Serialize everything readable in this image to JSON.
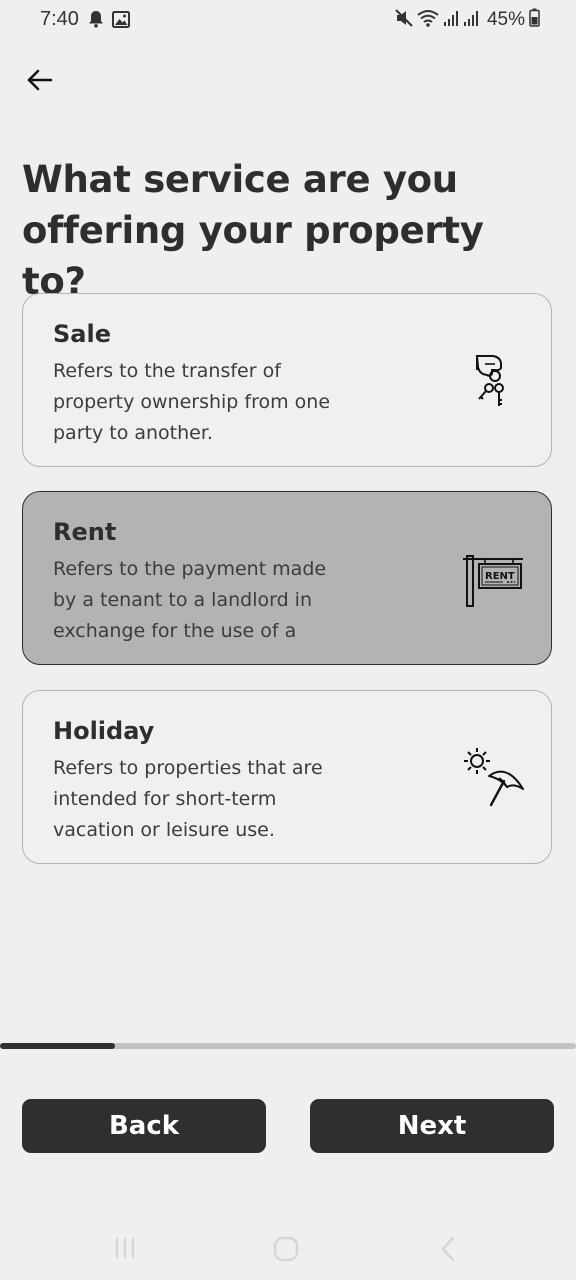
{
  "status_bar": {
    "time": "7:40",
    "battery": "45%",
    "icons": [
      "notification-bell-icon",
      "gallery-icon",
      "mute-icon",
      "wifi-icon",
      "signal-icon",
      "signal-icon",
      "battery-icon"
    ]
  },
  "header": {
    "back_icon": "arrow-left-icon",
    "title": "What service are you offering your property to?"
  },
  "options": [
    {
      "title": "Sale",
      "description": "Refers to the transfer of property ownership from one party to another.",
      "icon": "hand-keys-icon",
      "selected": false
    },
    {
      "title": "Rent",
      "description": "Refers to the payment made by a tenant to a landlord in exchange for the use of a",
      "icon": "rent-sign-icon",
      "icon_text": "RENT",
      "selected": true
    },
    {
      "title": "Holiday",
      "description": "Refers to properties that are intended for short-term vacation or leisure use.",
      "icon": "sun-umbrella-icon",
      "selected": false
    }
  ],
  "progress": {
    "value": 0.2
  },
  "footer": {
    "back_label": "Back",
    "next_label": "Next"
  },
  "nav_bar": {
    "icons": [
      "recents-icon",
      "home-icon",
      "back-icon"
    ]
  },
  "colors": {
    "background": "#efefef",
    "primary": "#2f2f2f",
    "selected_card": "#b3b3b3",
    "card_border": "#b4b4b4"
  }
}
